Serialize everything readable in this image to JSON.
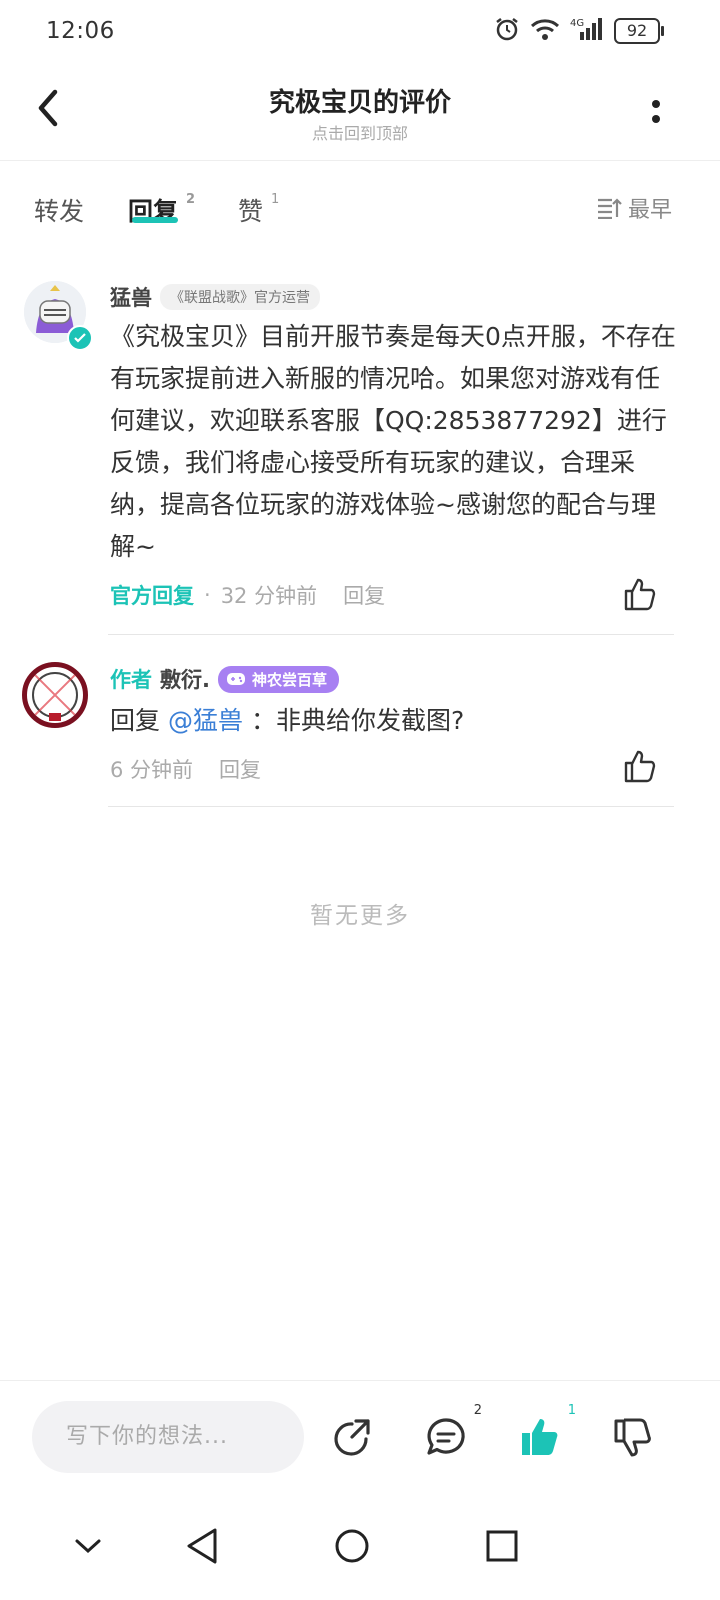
{
  "status": {
    "time": "12:06",
    "battery": "92",
    "network": "4G"
  },
  "header": {
    "title": "究极宝贝的评价",
    "subtitle": "点击回到顶部"
  },
  "tabs": [
    {
      "label": "转发",
      "count": ""
    },
    {
      "label": "回复",
      "count": "2"
    },
    {
      "label": "赞",
      "count": "1"
    }
  ],
  "sort_label": "最早",
  "comments": [
    {
      "name": "猛兽",
      "badge": "《联盟战歌》官方运营",
      "content": "《究极宝贝》目前开服节奏是每天0点开服，不存在有玩家提前进入新服的情况哈。如果您对游戏有任何建议，欢迎联系客服【QQ:2853877292】进行反馈，我们将虚心接受所有玩家的建议，合理采纳，提高各位玩家的游戏体验~感谢您的配合与理解~",
      "official_label": "官方回复",
      "time": "32 分钟前",
      "reply_label": "回复"
    },
    {
      "author_tag": "作者",
      "name": "敷衍.",
      "badge": "神农尝百草",
      "reply_prefix": "回复",
      "mention": "@猛兽",
      "content": "：非典给你发截图?",
      "time": "6 分钟前",
      "reply_label": "回复"
    }
  ],
  "no_more": "暂无更多",
  "bottom_bar": {
    "input_placeholder": "写下你的想法...",
    "comment_count": "2",
    "like_count": "1"
  },
  "colors": {
    "accent": "#1cc3b6",
    "badge_purple": "#a780f2",
    "mention": "#3b7fd6"
  }
}
